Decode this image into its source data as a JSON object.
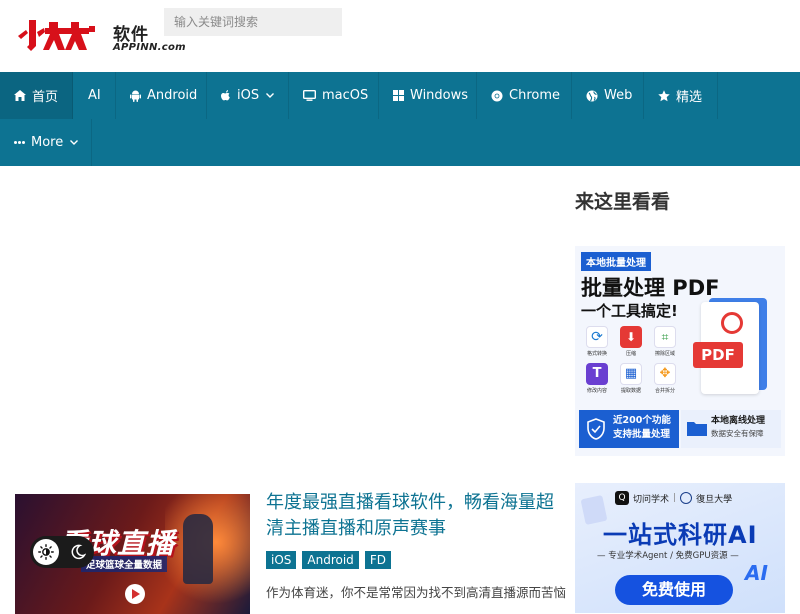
{
  "header": {
    "logo_cn": "软件",
    "logo_en": "APPINN.com",
    "search_placeholder": "输入关键词搜索"
  },
  "nav": {
    "items": [
      {
        "label": "首页",
        "icon": "home-icon"
      },
      {
        "label": "AI"
      },
      {
        "label": "Android",
        "icon": "android-icon"
      },
      {
        "label": "iOS",
        "icon": "apple-icon"
      },
      {
        "label": "macOS",
        "icon": "monitor-icon"
      },
      {
        "label": "Windows",
        "icon": "windows-icon"
      },
      {
        "label": "Chrome",
        "icon": "chrome-icon"
      },
      {
        "label": "Web",
        "icon": "globe-icon"
      },
      {
        "label": "精选",
        "icon": "star-icon"
      },
      {
        "label": "More",
        "icon": "ellipsis-icon"
      }
    ],
    "bg_color": "#0d7392"
  },
  "sidebar": {
    "title": "来这里看看",
    "ad1": {
      "badge": "本地批量处理",
      "headline": "批量处理 PDF",
      "subhead": "一个工具搞定!",
      "features": [
        "格式转换",
        "压缩",
        "擦除区域",
        "修改内容",
        "提取数据",
        "合并拆分"
      ],
      "pdf_label": "PDF",
      "bottom_left_1": "近200个功能",
      "bottom_left_2": "支持批量处理",
      "bottom_right_1": "本地离线处理",
      "bottom_right_2": "数据安全有保障"
    },
    "ad2": {
      "brand": "切问学术",
      "partner": "復旦大學",
      "headline": "一站式科研AI",
      "subhead": "— 专业学术Agent / 免费GPU资源 —",
      "cta": "免费使用",
      "corner": "AI"
    }
  },
  "post": {
    "thumb_text": "看球直播",
    "thumb_sub": "足球篮球全量数据",
    "title": "年度最强直播看球软件，畅看海量超清主播直播和原声赛事",
    "tags": [
      "iOS",
      "Android",
      "FD"
    ],
    "excerpt": "作为体育迷，你不是常常因为找不到高清直播源而苦恼"
  }
}
